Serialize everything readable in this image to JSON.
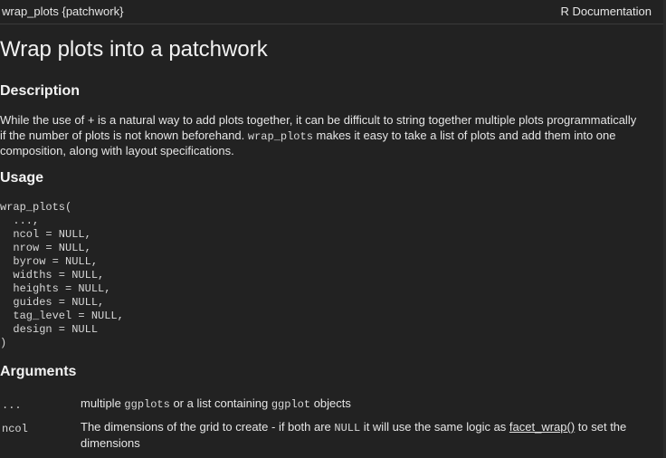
{
  "header": {
    "topic": "wrap_plots {patchwork}",
    "doc_label": "R Documentation"
  },
  "title": "Wrap plots into a patchwork",
  "description": {
    "heading": "Description",
    "line1": "While the use of + is a natural way to add plots together, it can be difficult to string together multiple plots programmatically",
    "line2_a": "if the number of plots is not known beforehand. ",
    "line2_code": "wrap_plots",
    "line2_b": " makes it easy to take a list of plots and add them into one",
    "line3": "composition, along with layout specifications."
  },
  "usage": {
    "heading": "Usage",
    "code": "wrap_plots(\n  ...,\n  ncol = NULL,\n  nrow = NULL,\n  byrow = NULL,\n  widths = NULL,\n  heights = NULL,\n  guides = NULL,\n  tag_level = NULL,\n  design = NULL\n)"
  },
  "arguments": {
    "heading": "Arguments",
    "items": [
      {
        "name": "...",
        "desc_a": "multiple ",
        "desc_code1": "ggplots",
        "desc_b": " or a list containing ",
        "desc_code2": "ggplot",
        "desc_c": " objects"
      },
      {
        "name": "ncol",
        "desc_a": "The dimensions of the grid to create - if both are ",
        "desc_code1": "NULL",
        "desc_b": " it will use the same logic as ",
        "desc_link": "facet_wrap()",
        "desc_c": " to set the",
        "desc_line2": "dimensions"
      }
    ]
  }
}
